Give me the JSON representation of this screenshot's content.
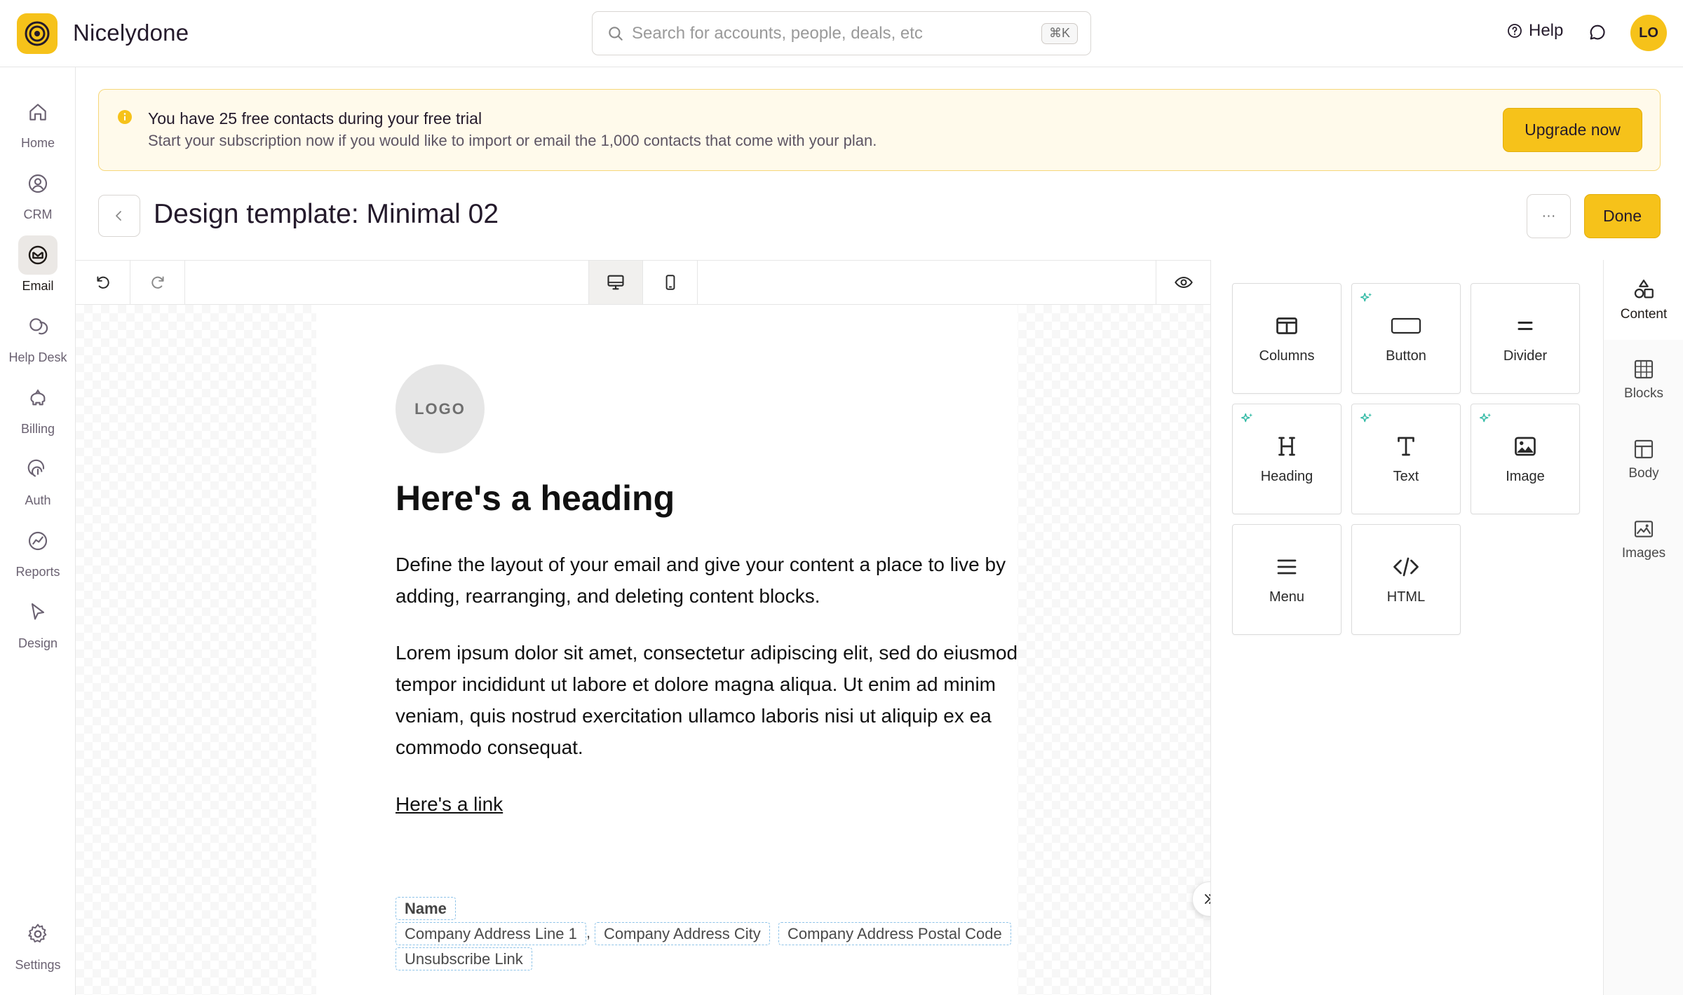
{
  "app": {
    "name": "Nicelydone"
  },
  "search": {
    "placeholder": "Search for accounts, people, deals, etc",
    "shortcut": "⌘K"
  },
  "header": {
    "help_label": "Help",
    "avatar_initials": "LO"
  },
  "nav": {
    "items": [
      {
        "label": "Home",
        "icon": "home-icon"
      },
      {
        "label": "CRM",
        "icon": "person-circle-icon"
      },
      {
        "label": "Email",
        "icon": "email-icon",
        "active": true
      },
      {
        "label": "Help Desk",
        "icon": "chat-bubbles-icon"
      },
      {
        "label": "Billing",
        "icon": "piggy-bank-icon"
      },
      {
        "label": "Auth",
        "icon": "fingerprint-icon"
      },
      {
        "label": "Reports",
        "icon": "chart-icon"
      },
      {
        "label": "Design",
        "icon": "cursor-icon"
      }
    ],
    "settings_label": "Settings"
  },
  "banner": {
    "title": "You have 25 free contacts during your free trial",
    "body": "Start your subscription now if you would like to import or email the 1,000 contacts that come with your plan.",
    "cta": "Upgrade now"
  },
  "page": {
    "title": "Design template: Minimal 02",
    "more_label": "···",
    "done_label": "Done"
  },
  "email": {
    "logo_text": "LOGO",
    "heading": "Here's a heading",
    "paragraph1": "Define the layout of your email and give your content a place to live by adding, rearranging, and deleting content blocks.",
    "paragraph2": "Lorem ipsum dolor sit amet, consectetur adipiscing elit, sed do eiusmod tempor incididunt ut labore et dolore magna aliqua. Ut enim ad minim veniam, quis nostrud exercitation ullamco laboris nisi ut aliquip ex ea commodo consequat.",
    "link": "Here's a link",
    "footer": {
      "name": "Name",
      "address_line1": "Company Address Line 1",
      "separator": ",",
      "city": "Company Address City",
      "postal_code": "Company Address Postal Code",
      "unsubscribe": "Unsubscribe Link"
    }
  },
  "content_blocks": [
    {
      "label": "Columns",
      "icon": "columns-icon",
      "ai": false
    },
    {
      "label": "Button",
      "icon": "button-icon",
      "ai": true
    },
    {
      "label": "Divider",
      "icon": "divider-icon",
      "ai": false
    },
    {
      "label": "Heading",
      "icon": "heading-icon",
      "ai": true
    },
    {
      "label": "Text",
      "icon": "text-icon",
      "ai": true
    },
    {
      "label": "Image",
      "icon": "image-icon",
      "ai": true
    },
    {
      "label": "Menu",
      "icon": "menu-icon",
      "ai": false
    },
    {
      "label": "HTML",
      "icon": "code-icon",
      "ai": false
    }
  ],
  "side_tabs": [
    {
      "label": "Content",
      "icon": "shapes-icon",
      "active": true
    },
    {
      "label": "Blocks",
      "icon": "blocks-icon"
    },
    {
      "label": "Body",
      "icon": "layout-icon"
    },
    {
      "label": "Images",
      "icon": "images-icon"
    }
  ],
  "colors": {
    "accent": "#f6c21a",
    "banner_bg": "#fffaeb",
    "banner_border": "#f6d77a",
    "ai_spark": "#2fb9a4",
    "merge_tag_border": "#8ec3e8"
  }
}
